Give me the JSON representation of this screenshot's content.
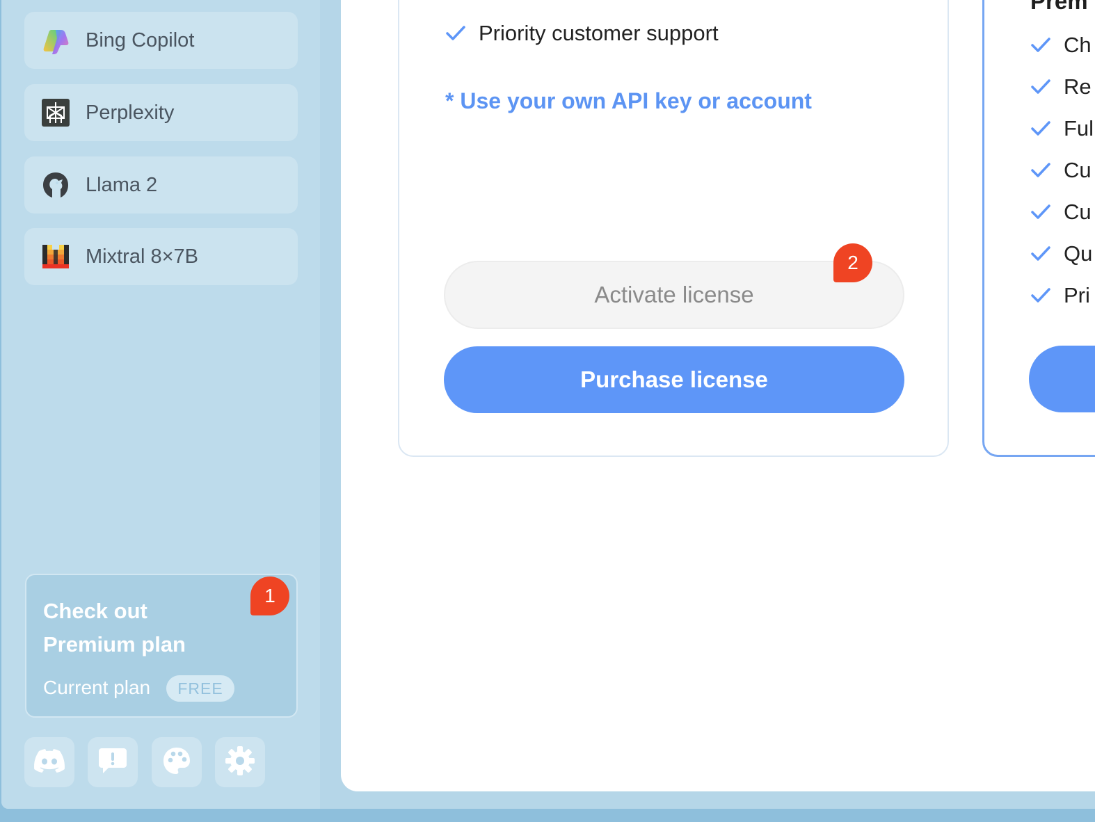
{
  "sidebar": {
    "bots": [
      {
        "label": "Bing Copilot",
        "icon": "copilot-icon"
      },
      {
        "label": "Perplexity",
        "icon": "perplexity-icon"
      },
      {
        "label": "Llama 2",
        "icon": "llama-icon"
      },
      {
        "label": "Mixtral 8×7B",
        "icon": "mistral-icon"
      }
    ],
    "premium_card": {
      "title": "Check out Premium plan",
      "current_plan_label": "Current plan",
      "plan_badge": "FREE",
      "notification_count": "1"
    },
    "footer_buttons": [
      {
        "icon": "discord-icon"
      },
      {
        "icon": "feedback-icon"
      },
      {
        "icon": "palette-icon"
      },
      {
        "icon": "settings-icon"
      }
    ]
  },
  "license_card": {
    "features": [
      "Priority customer support"
    ],
    "api_note": "* Use your own API key or account",
    "activate_label": "Activate license",
    "activate_notification": "2",
    "purchase_label": "Purchase license"
  },
  "premium_card": {
    "heading": "Prem",
    "features": [
      "Ch",
      "Re",
      "Ful",
      "Cu",
      "Cu",
      "Qu",
      "Pri"
    ]
  },
  "colors": {
    "accent": "#5e96f8",
    "badge": "#ef4423",
    "sidebar_bg": "#bddbeb"
  }
}
